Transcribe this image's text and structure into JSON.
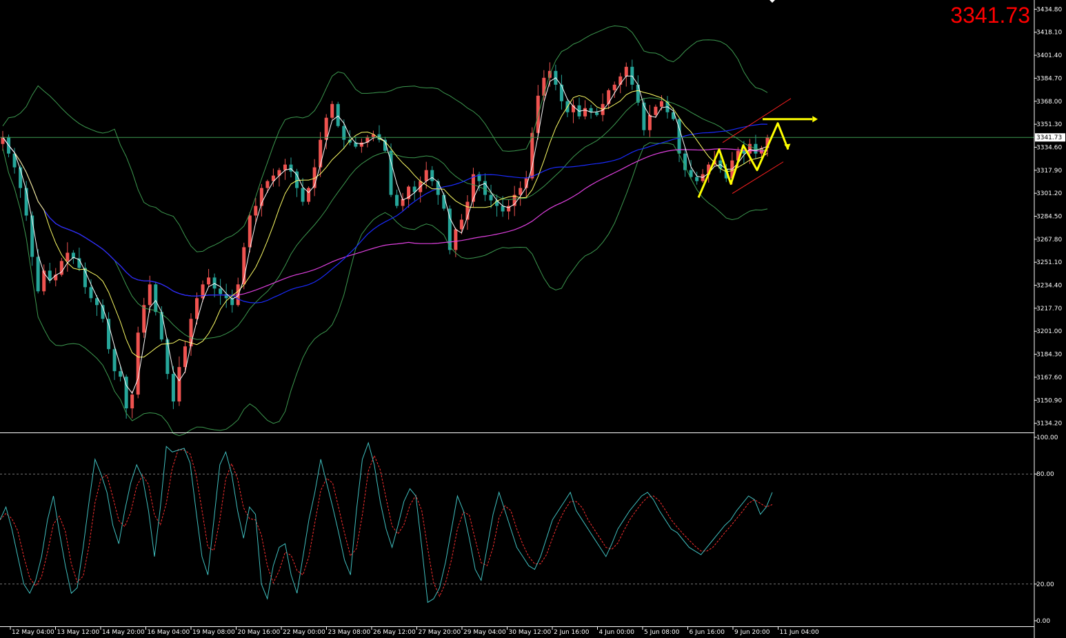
{
  "price_display": "3341.73",
  "current_price_tag": "3341.73",
  "colors": {
    "background": "#000000",
    "bull": "#ef5350",
    "bear": "#26a69a",
    "bollinger": "#3d9a50",
    "ma_fast": "#ffffff",
    "ma_mid": "#ffff66",
    "ma_blue": "#1a2bff",
    "ma_magenta": "#e040e0",
    "stoch_main": "#40c0c0",
    "stoch_signal": "#ff3030",
    "arrows": "#ffff00",
    "channel": "#ff2020",
    "price_line": "#3d9a50",
    "big_price": "#ff0000"
  },
  "chart_data": {
    "type": "candlestick",
    "price_axis": {
      "range": [
        3127.5,
        3441.5
      ],
      "ticks": [
        "3434.80",
        "3418.10",
        "3401.40",
        "3384.70",
        "3368.00",
        "3351.30",
        "3334.60",
        "3317.90",
        "3301.20",
        "3284.50",
        "3267.80",
        "3251.10",
        "3234.40",
        "3217.70",
        "3201.00",
        "3184.30",
        "3167.60",
        "3150.90",
        "3134.20"
      ]
    },
    "stoch_axis": {
      "range": [
        0,
        100
      ],
      "ticks": [
        "100.00",
        "80.00",
        "20.00",
        "0.00"
      ],
      "levels": [
        80,
        20
      ]
    },
    "time_labels": [
      "12 May 04:00",
      "13 May 12:00",
      "14 May 20:00",
      "16 May 04:00",
      "19 May 08:00",
      "20 May 16:00",
      "22 May 00:00",
      "23 May 08:00",
      "26 May 12:00",
      "27 May 20:00",
      "29 May 04:00",
      "30 May 12:00",
      "2 Jun 16:00",
      "4 Jun 00:00",
      "5 Jun 08:00",
      "6 Jun 16:00",
      "9 Jun 20:00",
      "11 Jun 04:00"
    ],
    "closes": [
      3342,
      3330,
      3320,
      3305,
      3285,
      3255,
      3230,
      3245,
      3238,
      3242,
      3252,
      3258,
      3254,
      3247,
      3233,
      3225,
      3220,
      3210,
      3188,
      3172,
      3168,
      3145,
      3155,
      3200,
      3220,
      3235,
      3215,
      3195,
      3170,
      3150,
      3175,
      3190,
      3210,
      3225,
      3235,
      3240,
      3232,
      3228,
      3225,
      3220,
      3235,
      3262,
      3285,
      3292,
      3305,
      3310,
      3314,
      3318,
      3322,
      3317,
      3305,
      3295,
      3305,
      3320,
      3340,
      3356,
      3366,
      3350,
      3340,
      3338,
      3335,
      3338,
      3342,
      3344,
      3340,
      3332,
      3300,
      3292,
      3297,
      3306,
      3302,
      3310,
      3318,
      3310,
      3300,
      3290,
      3260,
      3275,
      3282,
      3295,
      3315,
      3310,
      3300,
      3296,
      3292,
      3288,
      3292,
      3300,
      3305,
      3312,
      3345,
      3372,
      3385,
      3390,
      3380,
      3368,
      3360,
      3365,
      3357,
      3363,
      3360,
      3358,
      3366,
      3376,
      3380,
      3386,
      3393,
      3380,
      3367,
      3347,
      3358,
      3364,
      3368,
      3360,
      3355,
      3330,
      3318,
      3313,
      3310,
      3315,
      3322,
      3325,
      3319,
      3312,
      3325,
      3332,
      3330,
      3337,
      3330,
      3334,
      3341.73
    ],
    "stoch_main": [
      55,
      62,
      50,
      35,
      20,
      15,
      22,
      35,
      55,
      68,
      48,
      30,
      15,
      18,
      40,
      65,
      88,
      80,
      70,
      52,
      42,
      60,
      75,
      85,
      78,
      60,
      35,
      62,
      95,
      92,
      93,
      94,
      86,
      60,
      35,
      25,
      55,
      85,
      92,
      80,
      60,
      45,
      62,
      58,
      20,
      12,
      30,
      40,
      42,
      25,
      15,
      35,
      55,
      70,
      88,
      75,
      62,
      48,
      33,
      25,
      60,
      88,
      97,
      85,
      65,
      50,
      40,
      52,
      65,
      72,
      68,
      40,
      10,
      12,
      18,
      32,
      50,
      68,
      60,
      45,
      28,
      22,
      40,
      58,
      70,
      60,
      50,
      40,
      35,
      30,
      28,
      35,
      45,
      55,
      60,
      65,
      70,
      60,
      55,
      50,
      45,
      40,
      35,
      42,
      50,
      55,
      60,
      64,
      68,
      70,
      66,
      60,
      55,
      50,
      48,
      44,
      40,
      38,
      36,
      40,
      44,
      48,
      52,
      55,
      60,
      64,
      68,
      66,
      58,
      62,
      70
    ]
  }
}
